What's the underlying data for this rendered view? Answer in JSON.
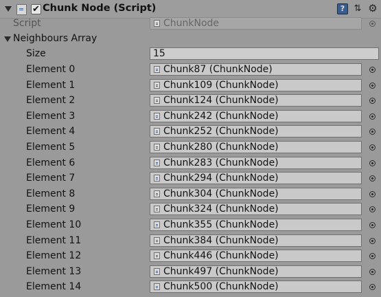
{
  "component": {
    "title": "Chunk Node (Script)",
    "enabled": "✔"
  },
  "script_field": {
    "label": "Script",
    "value": "ChunkNode"
  },
  "array": {
    "label": "Neighbours Array",
    "size_label": "Size",
    "size_value": "15",
    "elements": [
      {
        "label": "Element 0",
        "value": "Chunk87 (ChunkNode)"
      },
      {
        "label": "Element 1",
        "value": "Chunk109 (ChunkNode)"
      },
      {
        "label": "Element 2",
        "value": "Chunk124 (ChunkNode)"
      },
      {
        "label": "Element 3",
        "value": "Chunk242 (ChunkNode)"
      },
      {
        "label": "Element 4",
        "value": "Chunk252 (ChunkNode)"
      },
      {
        "label": "Element 5",
        "value": "Chunk280 (ChunkNode)"
      },
      {
        "label": "Element 6",
        "value": "Chunk283 (ChunkNode)"
      },
      {
        "label": "Element 7",
        "value": "Chunk294 (ChunkNode)"
      },
      {
        "label": "Element 8",
        "value": "Chunk304 (ChunkNode)"
      },
      {
        "label": "Element 9",
        "value": "Chunk324 (ChunkNode)"
      },
      {
        "label": "Element 10",
        "value": "Chunk355 (ChunkNode)"
      },
      {
        "label": "Element 11",
        "value": "Chunk384 (ChunkNode)"
      },
      {
        "label": "Element 12",
        "value": "Chunk446 (ChunkNode)"
      },
      {
        "label": "Element 13",
        "value": "Chunk497 (ChunkNode)"
      },
      {
        "label": "Element 14",
        "value": "Chunk500 (ChunkNode)"
      }
    ]
  },
  "icons": {
    "help": "?",
    "preset": "⇅",
    "gear": "⚙"
  }
}
